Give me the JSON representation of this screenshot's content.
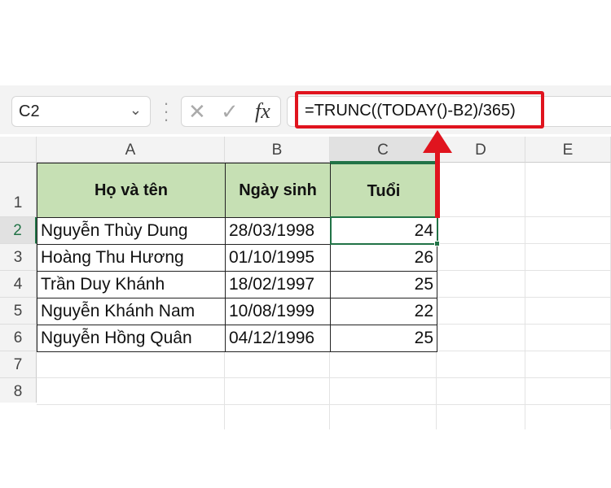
{
  "formula_bar": {
    "name_box": "C2",
    "cancel_icon": "✕",
    "enter_icon": "✓",
    "fx_label": "fx",
    "formula": "=TRUNC((TODAY()-B2)/365)"
  },
  "columns": [
    "A",
    "B",
    "C",
    "D",
    "E"
  ],
  "rows": [
    "1",
    "2",
    "3",
    "4",
    "5",
    "6",
    "7",
    "8"
  ],
  "table": {
    "headers": [
      "Họ và tên",
      "Ngày sinh",
      "Tuổi"
    ],
    "data": [
      [
        "Nguyễn Thùy Dung",
        "28/03/1998",
        "24"
      ],
      [
        "Hoàng Thu Hương",
        "01/10/1995",
        "26"
      ],
      [
        "Trần Duy Khánh",
        "18/02/1997",
        "25"
      ],
      [
        "Nguyễn Khánh Nam",
        "10/08/1999",
        "22"
      ],
      [
        "Nguyễn Hồng Quân",
        "04/12/1996",
        "25"
      ]
    ]
  },
  "colors": {
    "header_fill": "#c6e0b4",
    "highlight": "#e0141e",
    "selection": "#217346"
  }
}
